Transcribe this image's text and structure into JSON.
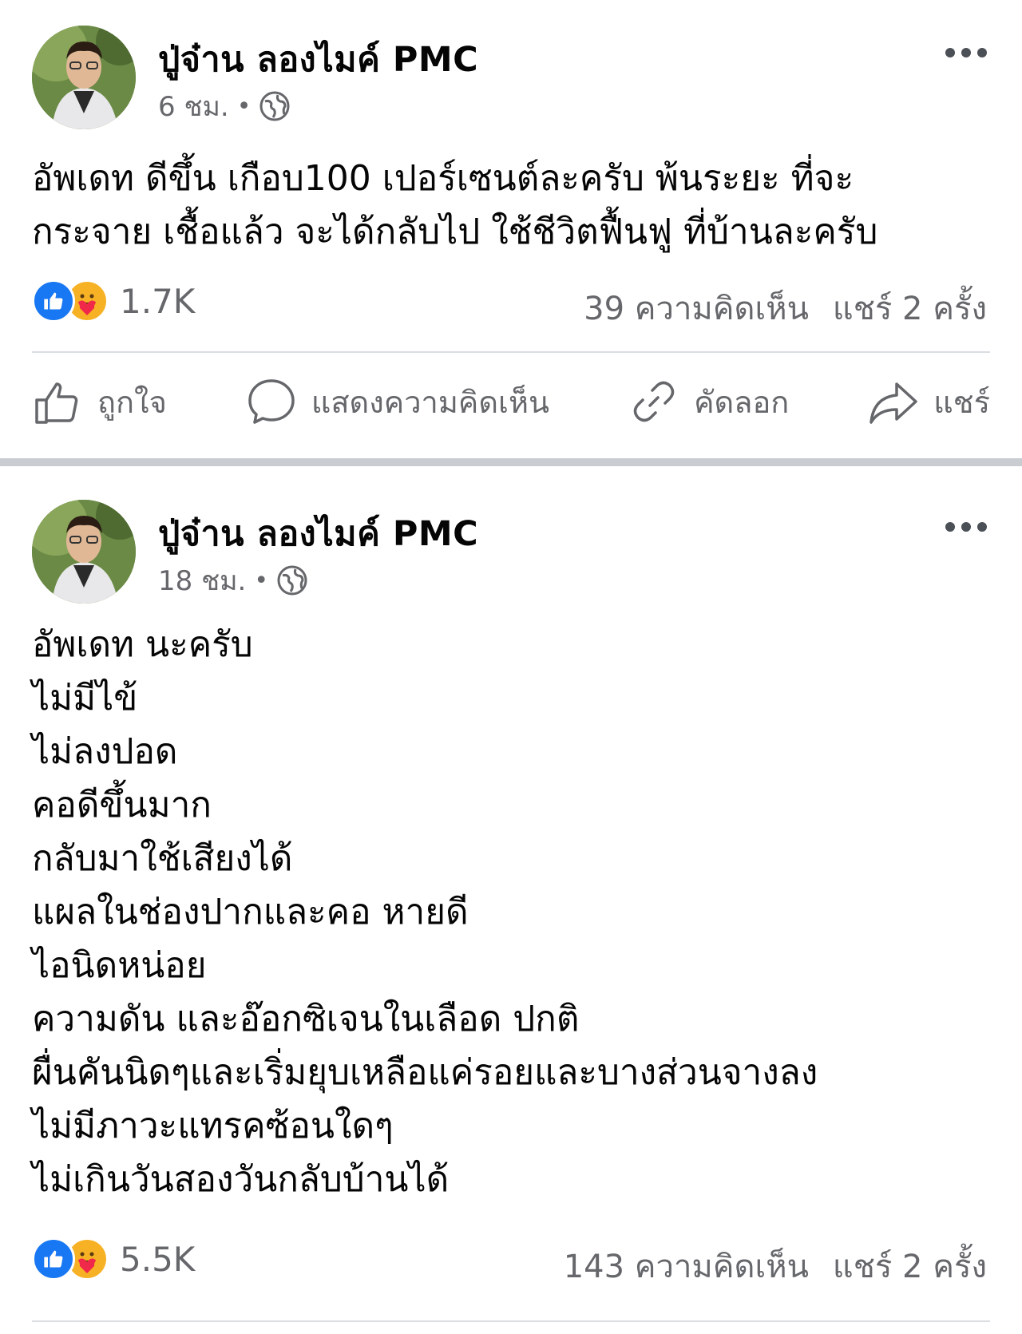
{
  "posts": [
    {
      "author": "ปู่จ๋าน ลองไมค์ PMC",
      "time": "6 ชม.",
      "separator": "•",
      "lines": [
        "อัพเดท ดีขึ้น เกือบ100 เปอร์เซนต์ละครับ พ้นระยะ ที่จะ",
        "กระจาย เชื้อแล้ว จะได้กลับไป ใช้ชีวิตฟื้นฟู ที่บ้านละครับ"
      ],
      "reaction_count": "1.7K",
      "comments": "39 ความคิดเห็น",
      "shares": "แชร์ 2 ครั้ง"
    },
    {
      "author": "ปู่จ๋าน ลองไมค์ PMC",
      "time": "18 ชม.",
      "separator": "•",
      "lines": [
        "อัพเดท นะครับ",
        "ไม่มีไข้",
        "ไม่ลงปอด",
        "คอดีขึ้นมาก",
        "กลับมาใช้เสียงได้",
        "แผลในช่องปากและคอ หายดี",
        "ไอนิดหน่อย",
        "ความดัน และอ๊อกซิเจนในเลือด ปกติ",
        "ผื่นคันนิดๆและเริ่มยุบเหลือแค่รอยและบางส่วนจางลง",
        "ไม่มีภาวะแทรคซ้อนใดๆ",
        "ไม่เกินวันสองวันกลับบ้านได้"
      ],
      "reaction_count": "5.5K",
      "comments": "143 ความคิดเห็น",
      "shares": "แชร์ 2 ครั้ง"
    }
  ],
  "actions": {
    "like": "ถูกใจ",
    "comment": "แสดงความคิดเห็น",
    "copy": "คัดลอก",
    "share": "แชร์"
  },
  "icons": {
    "like_reaction": "like-reaction-icon",
    "care_reaction": "care-reaction-icon",
    "privacy": "globe-icon",
    "more": "more-icon"
  },
  "colors": {
    "like_blue": "#1877f2",
    "care_yellow": "#f7b125",
    "secondary_text": "#65676b",
    "separator": "#c9ccd1"
  }
}
